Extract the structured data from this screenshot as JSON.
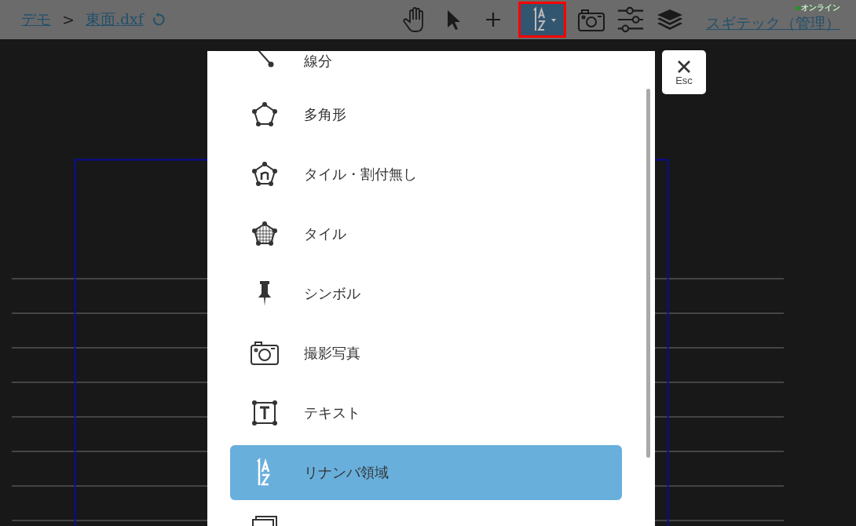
{
  "breadcrumb": {
    "items": [
      {
        "label": "デモ"
      },
      {
        "label": "東面.dxf"
      }
    ],
    "separator": ">"
  },
  "toolbar": [
    {
      "kind": "hand",
      "selected": false
    },
    {
      "kind": "pointer",
      "selected": false
    },
    {
      "kind": "plus",
      "selected": false
    },
    {
      "kind": "renumber",
      "selected": true
    },
    {
      "kind": "camera",
      "selected": false
    },
    {
      "kind": "sliders",
      "selected": false
    },
    {
      "kind": "layers",
      "selected": false
    }
  ],
  "user": {
    "name": "スギテック（管理）",
    "status": "オンライン",
    "online": true
  },
  "close_button": {
    "label": "Esc"
  },
  "menu": {
    "items": [
      {
        "kind": "segment",
        "label": "線分",
        "selected": false
      },
      {
        "kind": "polygon",
        "label": "多角形",
        "selected": false
      },
      {
        "kind": "polygon-n",
        "label": "タイル・割付無し",
        "selected": false
      },
      {
        "kind": "polygon-grid",
        "label": "タイル",
        "selected": false
      },
      {
        "kind": "pin",
        "label": "シンボル",
        "selected": false
      },
      {
        "kind": "camera",
        "label": "撮影写真",
        "selected": false
      },
      {
        "kind": "text",
        "label": "テキスト",
        "selected": false
      },
      {
        "kind": "renumber",
        "label": "リナンバ領域",
        "selected": true
      },
      {
        "kind": "image",
        "selected": false
      }
    ]
  }
}
